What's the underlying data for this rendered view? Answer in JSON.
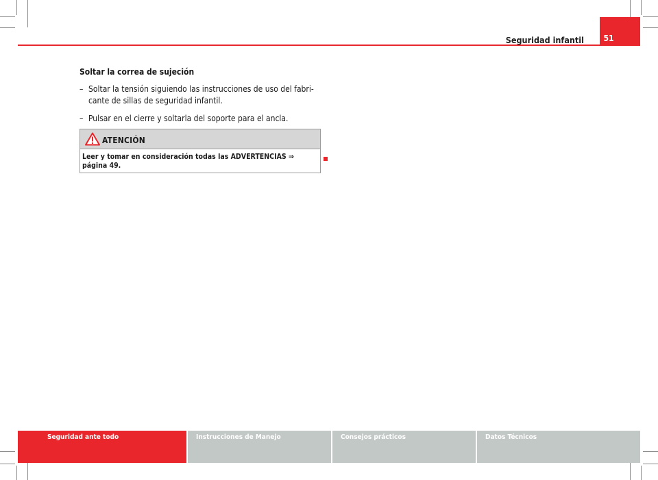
{
  "header": {
    "section_title": "Seguridad infantil",
    "page_number": "51"
  },
  "content": {
    "heading": "Soltar la correa de sujeción",
    "steps": [
      {
        "bullet": "–",
        "line1": "Soltar la tensión siguiendo las instrucciones de uso del fabri-",
        "line2": "cante de sillas de seguridad infantil."
      },
      {
        "bullet": "–",
        "line1": "Pulsar en el cierre y soltarla del soporte para el ancla."
      }
    ]
  },
  "warning": {
    "icon": "warning-triangle-icon",
    "title": "ATENCIÓN",
    "text": "Leer y tomar en consideración todas las ADVERTENCIAS ⇒ página 49."
  },
  "footer": {
    "tabs": [
      {
        "label": "Seguridad ante todo",
        "active": true
      },
      {
        "label": "Instrucciones de Manejo",
        "active": false
      },
      {
        "label": "Consejos prácticos",
        "active": false
      },
      {
        "label": "Datos Técnicos",
        "active": false
      }
    ]
  },
  "colors": {
    "accent": "#e8262b",
    "footer_inactive": "#c2c8c6",
    "warning_header": "#d6d6d6"
  }
}
